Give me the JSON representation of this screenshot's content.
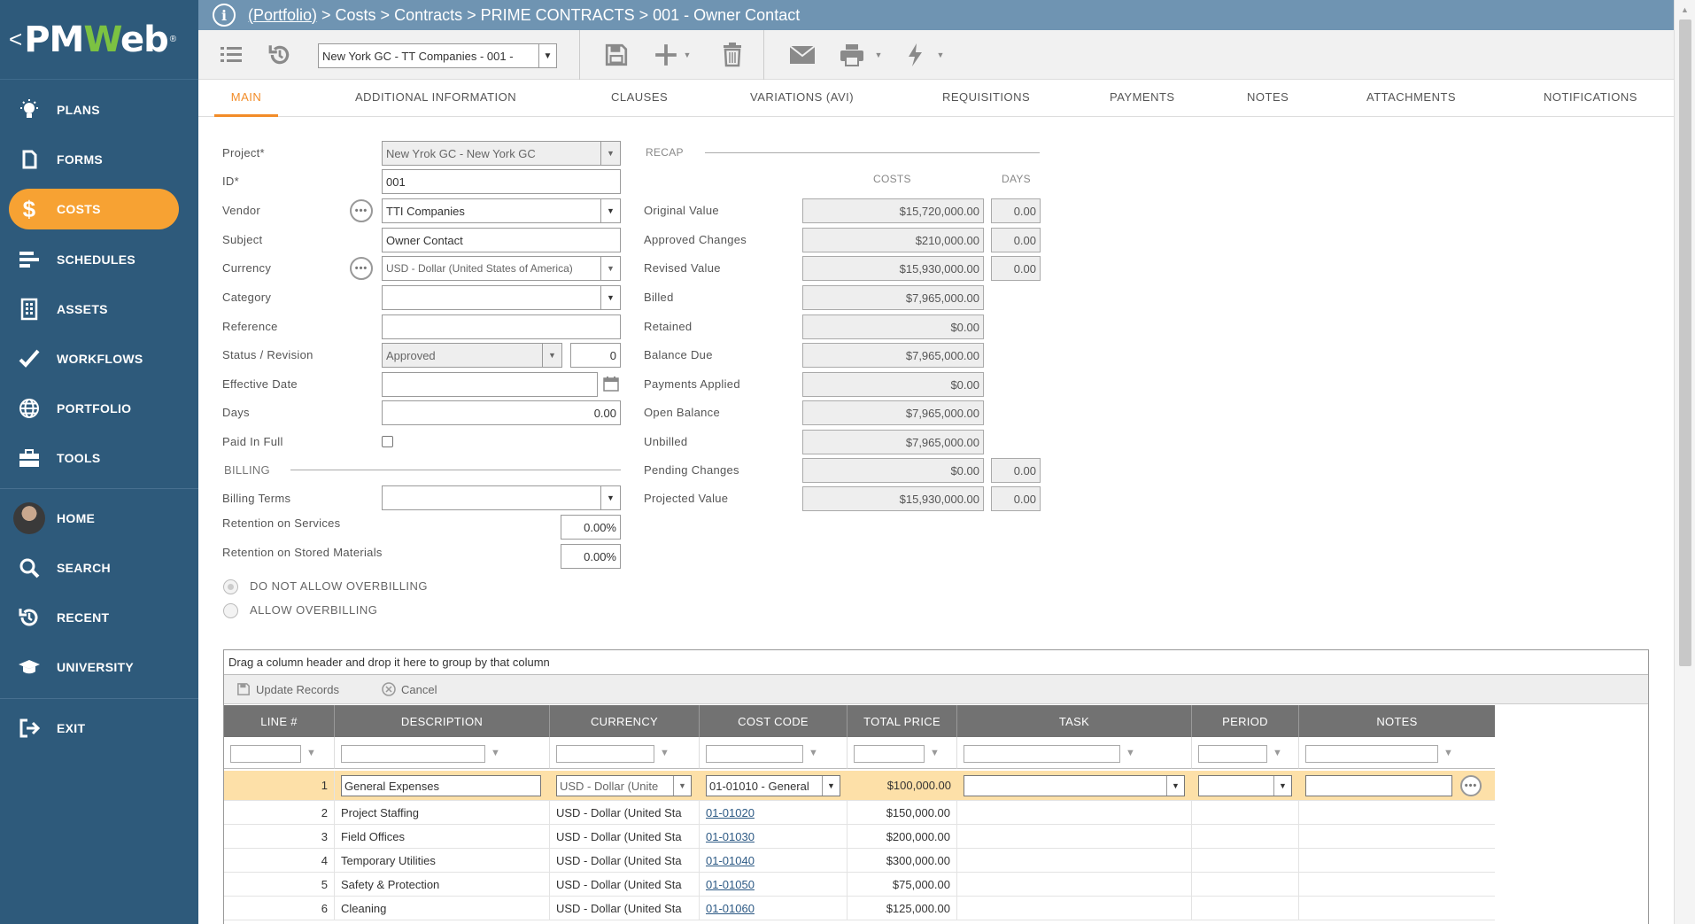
{
  "sidebar": {
    "logo": {
      "back": "<",
      "pm": "PM",
      "w": "W",
      "eb": "eb",
      "reg": "®"
    },
    "items": [
      {
        "label": "PLANS",
        "icon": "lightbulb-icon"
      },
      {
        "label": "FORMS",
        "icon": "document-icon"
      },
      {
        "label": "COSTS",
        "icon": "dollar-icon",
        "active": true
      },
      {
        "label": "SCHEDULES",
        "icon": "gantt-icon"
      },
      {
        "label": "ASSETS",
        "icon": "building-icon"
      },
      {
        "label": "WORKFLOWS",
        "icon": "checkmark-icon"
      },
      {
        "label": "PORTFOLIO",
        "icon": "globe-icon"
      },
      {
        "label": "TOOLS",
        "icon": "toolbox-icon"
      },
      {
        "label": "HOME",
        "icon": "avatar"
      },
      {
        "label": "SEARCH",
        "icon": "search-icon"
      },
      {
        "label": "RECENT",
        "icon": "history-icon"
      },
      {
        "label": "UNIVERSITY",
        "icon": "graduation-cap-icon"
      },
      {
        "label": "EXIT",
        "icon": "exit-icon"
      }
    ]
  },
  "breadcrumb": {
    "link": "(Portfolio)",
    "rest": " > Costs > Contracts > PRIME CONTRACTS > 001 - Owner Contact"
  },
  "toolbar": {
    "record_select": "New York GC - TT  Companies - 001 -"
  },
  "tabs": [
    "MAIN",
    "ADDITIONAL INFORMATION",
    "CLAUSES",
    "VARIATIONS (AVI)",
    "REQUISITIONS",
    "PAYMENTS",
    "NOTES",
    "ATTACHMENTS",
    "NOTIFICATIONS"
  ],
  "form": {
    "project_label": "Project*",
    "project_value": "New Yrok GC - New York GC",
    "id_label": "ID*",
    "id_value": "001",
    "vendor_label": "Vendor",
    "vendor_value": "TTI Companies",
    "subject_label": "Subject",
    "subject_value": "Owner Contact",
    "currency_label": "Currency",
    "currency_value": "USD - Dollar (United States of America)",
    "category_label": "Category",
    "category_value": "",
    "reference_label": "Reference",
    "reference_value": "",
    "status_label": "Status / Revision",
    "status_value": "Approved",
    "revision_value": "0",
    "effective_label": "Effective Date",
    "effective_value": "",
    "days_label": "Days",
    "days_value": "0.00",
    "paid_label": "Paid In Full",
    "billing_section": "BILLING",
    "billing_terms_label": "Billing Terms",
    "billing_terms_value": "",
    "ret_services_label": "Retention on Services",
    "ret_services_value": "0.00%",
    "ret_stored_label": "Retention on Stored Materials",
    "ret_stored_value": "0.00%",
    "radio_no_overbilling": "DO NOT ALLOW OVERBILLING",
    "radio_allow_overbilling": "ALLOW OVERBILLING"
  },
  "recap": {
    "title": "RECAP",
    "costs_header": "COSTS",
    "days_header": "DAYS",
    "rows": [
      {
        "label": "Original Value",
        "cost": "$15,720,000.00",
        "days": "0.00"
      },
      {
        "label": "Approved Changes",
        "cost": "$210,000.00",
        "days": "0.00"
      },
      {
        "label": "Revised Value",
        "cost": "$15,930,000.00",
        "days": "0.00"
      },
      {
        "label": "Billed",
        "cost": "$7,965,000.00"
      },
      {
        "label": "Retained",
        "cost": "$0.00"
      },
      {
        "label": "Balance Due",
        "cost": "$7,965,000.00"
      },
      {
        "label": "Payments Applied",
        "cost": "$0.00"
      },
      {
        "label": "Open Balance",
        "cost": "$7,965,000.00"
      },
      {
        "label": "Unbilled",
        "cost": "$7,965,000.00"
      },
      {
        "label": "Pending Changes",
        "cost": "$0.00",
        "days": "0.00"
      },
      {
        "label": "Projected Value",
        "cost": "$15,930,000.00",
        "days": "0.00"
      }
    ]
  },
  "grid": {
    "group_hint": "Drag a column header and drop it here to group by that column",
    "update_label": "Update Records",
    "cancel_label": "Cancel",
    "columns": [
      "LINE #",
      "DESCRIPTION",
      "CURRENCY",
      "COST CODE",
      "TOTAL PRICE",
      "TASK",
      "PERIOD",
      "NOTES"
    ],
    "edit_row": {
      "line": "1",
      "description": "General Expenses",
      "currency": "USD - Dollar (Unite",
      "cost_code": "01-01010 - General",
      "total": "$100,000.00"
    },
    "rows": [
      {
        "line": "2",
        "description": "Project Staffing",
        "currency": "USD - Dollar (United Sta",
        "cost_code": "01-01020",
        "total": "$150,000.00"
      },
      {
        "line": "3",
        "description": "Field Offices",
        "currency": "USD - Dollar (United Sta",
        "cost_code": "01-01030",
        "total": "$200,000.00"
      },
      {
        "line": "4",
        "description": "Temporary Utilities",
        "currency": "USD - Dollar (United Sta",
        "cost_code": "01-01040",
        "total": "$300,000.00"
      },
      {
        "line": "5",
        "description": "Safety & Protection",
        "currency": "USD - Dollar (United Sta",
        "cost_code": "01-01050",
        "total": "$75,000.00"
      },
      {
        "line": "6",
        "description": "Cleaning",
        "currency": "USD - Dollar (United Sta",
        "cost_code": "01-01060",
        "total": "$125,000.00"
      }
    ]
  },
  "colors": {
    "sidebar": "#2e5a7b",
    "active": "#f7a233",
    "topbar": "#6f94b2",
    "tab_active": "#f28c28",
    "grid_header": "#727272",
    "selected_row": "#fde0a8"
  }
}
